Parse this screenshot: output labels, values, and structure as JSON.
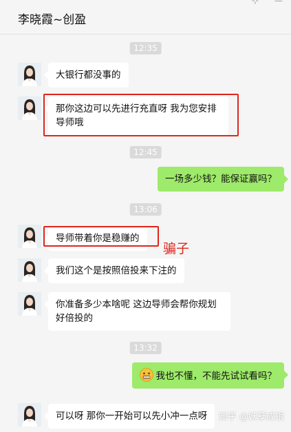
{
  "header": {
    "title": "李晓霞~创盈"
  },
  "window_controls": {
    "pin": "⊹",
    "minimize": "—"
  },
  "timestamps": [
    "12:35",
    "12:45",
    "13:06",
    "13:32"
  ],
  "messages": [
    {
      "side": "in",
      "text": "大银行都没事的"
    },
    {
      "side": "in",
      "text": "那你这边可以先进行充直呀 我为您安排导师哦"
    },
    {
      "side": "out",
      "text": "一场多少钱？能保证赢吗？"
    },
    {
      "side": "in",
      "text": "导师带着你是稳赚的"
    },
    {
      "side": "in",
      "text": "我们这个是按照倍投来下注的"
    },
    {
      "side": "in",
      "text": "你准备多少本啥呢  这边导师会帮你规划好倍投的"
    },
    {
      "side": "out",
      "text": "我也不懂，不能先试试看吗？",
      "emoji": "grimace-emoji"
    },
    {
      "side": "in",
      "text": "可以呀   那你一开始可以先小冲一点呀"
    }
  ],
  "annotation": {
    "text": "骗子",
    "color": "#e0251b"
  },
  "watermark": "知乎 @妖孽成银",
  "colors": {
    "bubble_out": "#9eea6a",
    "bubble_in": "#ffffff",
    "background": "#f5f5f5",
    "highlight": "#e0251b"
  }
}
